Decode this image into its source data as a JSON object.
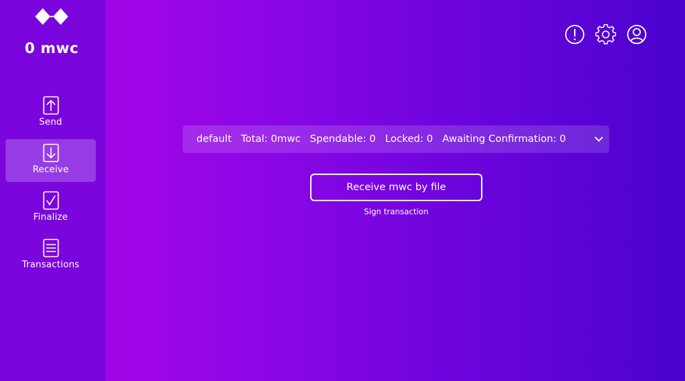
{
  "sidebar": {
    "balance": "0 mwc",
    "items": [
      {
        "label": "Send",
        "icon": "send-arrow-up-icon",
        "active": false
      },
      {
        "label": "Receive",
        "icon": "receive-arrow-down-icon",
        "active": true
      },
      {
        "label": "Finalize",
        "icon": "finalize-check-icon",
        "active": false
      },
      {
        "label": "Transactions",
        "icon": "transactions-list-icon",
        "active": false
      }
    ]
  },
  "header": {
    "icons": [
      "alert-icon",
      "settings-gear-icon",
      "account-user-icon"
    ]
  },
  "main": {
    "account_selector": {
      "name": "default",
      "total": "Total: 0mwc",
      "spendable": "Spendable: 0",
      "locked": "Locked: 0",
      "awaiting": "Awaiting Confirmation: 0"
    },
    "receive_button_label": "Receive mwc by file",
    "sign_transaction_label": "Sign transaction"
  },
  "colors": {
    "sidebar_bg": "#7a06dd",
    "gradient_start": "#a305e6",
    "gradient_end": "#4a02ce",
    "text": "#ffffff"
  }
}
